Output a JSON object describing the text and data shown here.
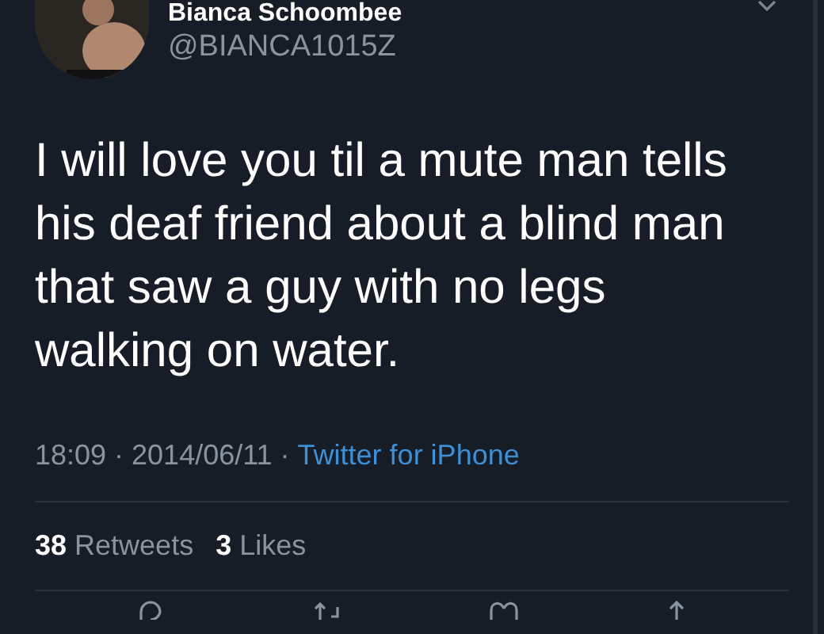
{
  "author": {
    "name": "Bianca Schoombee",
    "handle": "@BIANCA1015Z"
  },
  "text": "I will love you til a mute man tells his deaf friend about a blind man that saw a guy with no legs walking on water.",
  "meta": {
    "timestamp": "18:09 · 2014/06/11 ·",
    "source": "Twitter for iPhone"
  },
  "stats": [
    {
      "count": "38",
      "label": "Retweets"
    },
    {
      "count": "3",
      "label": "Likes"
    }
  ]
}
